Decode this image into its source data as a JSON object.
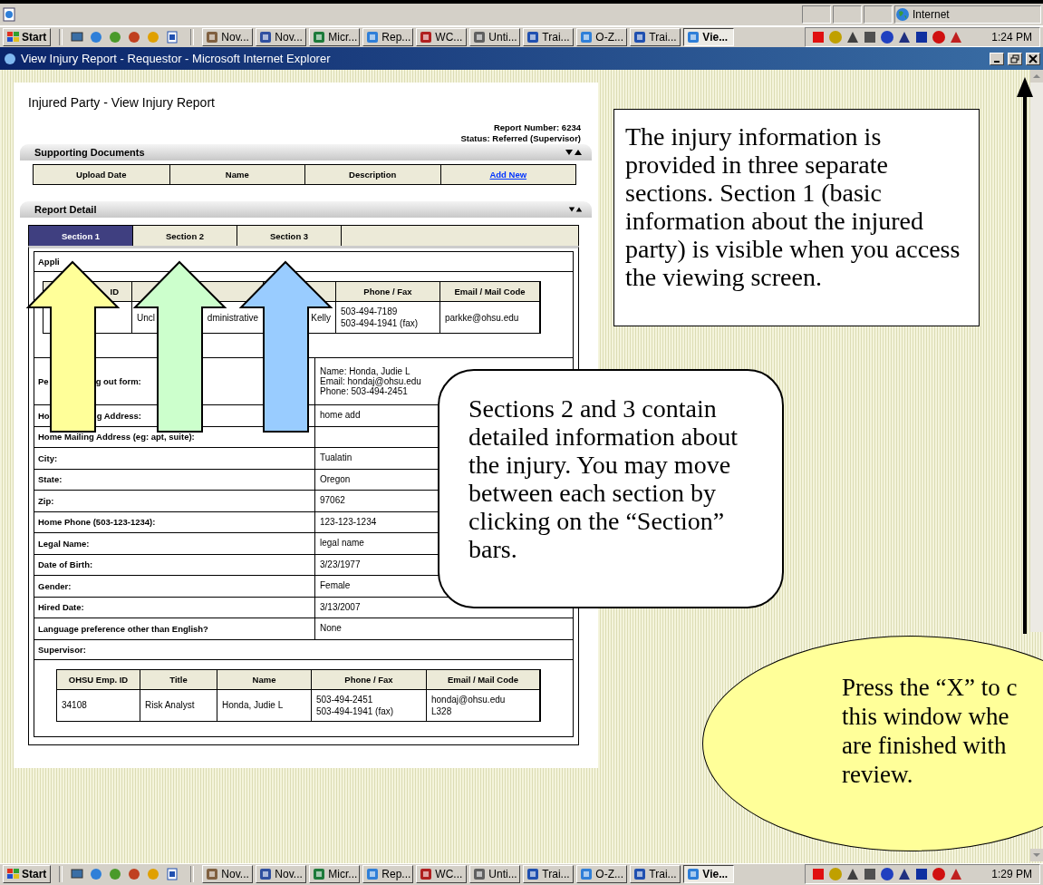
{
  "status_bar": {
    "zone": "Internet"
  },
  "taskbar_top": {
    "start": "Start",
    "tasks": [
      {
        "label": "Nov...",
        "selected": false
      },
      {
        "label": "Nov...",
        "selected": false
      },
      {
        "label": "Micr...",
        "selected": false
      },
      {
        "label": "Rep...",
        "selected": false
      },
      {
        "label": "WC...",
        "selected": false
      },
      {
        "label": "Unti...",
        "selected": false
      },
      {
        "label": "Trai...",
        "selected": false
      },
      {
        "label": "O-Z...",
        "selected": false
      },
      {
        "label": "Trai...",
        "selected": false
      },
      {
        "label": "Vie...",
        "selected": true
      }
    ],
    "clock": "1:24 PM"
  },
  "window": {
    "title": "View Injury Report - Requestor - Microsoft Internet Explorer"
  },
  "page": {
    "title": "Injured Party - View Injury Report",
    "report_number": "Report Number: 6234",
    "status": "Status: Referred (Supervisor)",
    "supporting_documents": {
      "heading": "Supporting Documents",
      "columns": [
        "Upload Date",
        "Name",
        "Description"
      ],
      "add_link": "Add New"
    },
    "report_detail": {
      "heading": "Report Detail",
      "tabs": [
        {
          "label": "Section 1",
          "selected": true
        },
        {
          "label": "Section 2",
          "selected": false
        },
        {
          "label": "Section 3",
          "selected": false
        }
      ],
      "applicant_label": "Appli",
      "applicant_table": {
        "header": [
          {
            "kind": "text",
            "lines": [
              "ID"
            ]
          },
          {
            "kind": "covered"
          },
          {
            "kind": "covered"
          },
          {
            "kind": "text",
            "lines": [
              "Phone / Fax"
            ]
          },
          {
            "kind": "text",
            "lines": [
              "Email / Mail Code"
            ]
          }
        ],
        "row": [
          {
            "kind": "covered"
          },
          {
            "kind": "split",
            "parts": [
              "Uncl",
              "dministrative"
            ]
          },
          {
            "kind": "text",
            "lines": [
              "Kelly"
            ]
          },
          {
            "kind": "text",
            "lines": [
              "503-494-7189",
              "503-494-1941 (fax)"
            ]
          },
          {
            "kind": "text",
            "lines": [
              "parkke@ohsu.edu"
            ]
          }
        ]
      },
      "fields": [
        {
          "kind": "split",
          "label_parts": [
            "Pe",
            "g out form:"
          ],
          "value_lines": [
            "Name: Honda, Judie L",
            "Email: hondaj@ohsu.edu",
            "Phone: 503-494-2451"
          ]
        },
        {
          "kind": "split",
          "label_parts": [
            "Ho",
            "g Address:"
          ],
          "value_lines": [
            "home add"
          ]
        },
        {
          "kind": "plain",
          "label": "Home Mailing Address (eg: apt, suite):"
        },
        {
          "kind": "plain",
          "label": "City:",
          "value_lines": [
            "Tualatin"
          ]
        },
        {
          "kind": "plain",
          "label": "State:",
          "value_lines": [
            "Oregon"
          ]
        },
        {
          "kind": "plain",
          "label": "Zip:",
          "value_lines": [
            "97062"
          ]
        },
        {
          "kind": "plain",
          "label": "Home Phone (503-123-1234):",
          "value_lines": [
            "123-123-1234"
          ]
        },
        {
          "kind": "plain",
          "label": "Legal Name:",
          "value_lines": [
            "legal name"
          ]
        },
        {
          "kind": "plain",
          "label": "Date of Birth:",
          "value_lines": [
            "3/23/1977"
          ]
        },
        {
          "kind": "plain",
          "label": "Gender:",
          "value_lines": [
            "Female"
          ]
        },
        {
          "kind": "plain",
          "label": "Hired Date:",
          "value_lines": [
            "3/13/2007"
          ]
        },
        {
          "kind": "plain",
          "label": "Language preference other than English?",
          "value_lines": [
            "None"
          ]
        }
      ],
      "supervisor_label": "Supervisor:",
      "supervisor_table": {
        "header": [
          "OHSU Emp. ID",
          "Title",
          "Name",
          "Phone / Fax",
          "Email / Mail Code"
        ],
        "row": [
          [
            "34108"
          ],
          [
            "Risk Analyst"
          ],
          [
            "Honda, Judie L"
          ],
          [
            "503-494-2451",
            "503-494-1941 (fax)"
          ],
          [
            "hondaj@ohsu.edu",
            "L328"
          ]
        ]
      }
    }
  },
  "annotations": {
    "box_note": "The injury information is provided in three separate sections.  Section 1 (basic information about the injured party) is visible when you access the viewing screen.",
    "bubble_note": "Sections 2 and 3 contain detailed information about the injury.  You may move between each section by clicking on the “Section” bars.",
    "ellipse_note_lines": [
      "Press the “X” to c",
      "this window whe",
      "are finished with",
      "review."
    ]
  },
  "taskbar_bottom": {
    "start": "Start",
    "tasks": [
      {
        "label": "Nov...",
        "selected": false
      },
      {
        "label": "Nov...",
        "selected": false
      },
      {
        "label": "Micr...",
        "selected": false
      },
      {
        "label": "Rep...",
        "selected": false
      },
      {
        "label": "WC...",
        "selected": false
      },
      {
        "label": "Unti...",
        "selected": false
      },
      {
        "label": "Trai...",
        "selected": false
      },
      {
        "label": "O-Z...",
        "selected": false
      },
      {
        "label": "Trai...",
        "selected": false
      },
      {
        "label": "Vie...",
        "selected": true
      }
    ],
    "clock": "1:29 PM"
  }
}
